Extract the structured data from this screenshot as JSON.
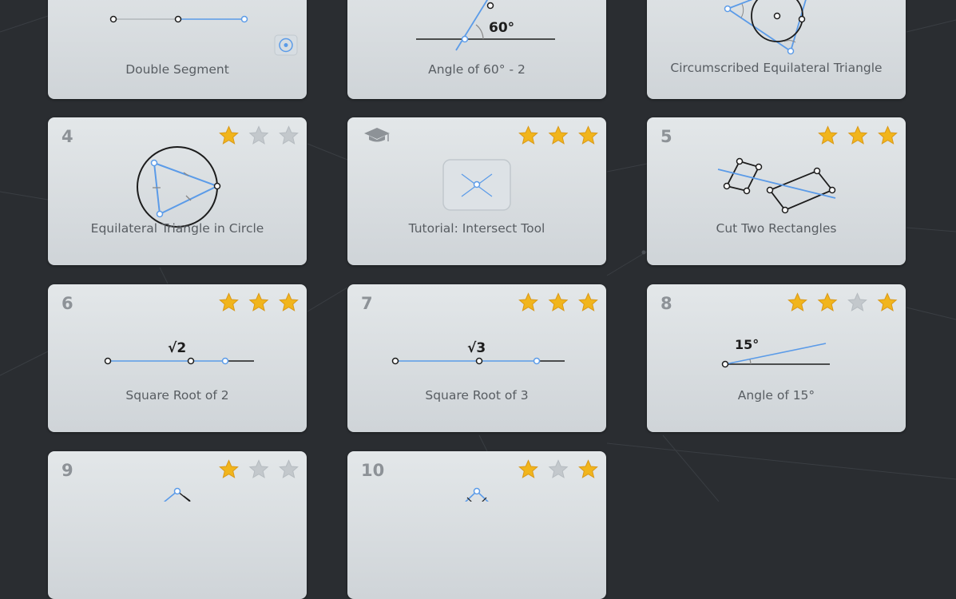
{
  "levels": [
    {
      "title": "Double Segment",
      "stars": null
    },
    {
      "title": "Angle of 60° - 2",
      "stars": null,
      "label": "60°"
    },
    {
      "title": "Circumscribed Equilateral Triangle",
      "stars": null
    },
    {
      "number": "4",
      "title": "Equilateral Triangle in Circle",
      "stars": [
        true,
        false,
        false
      ]
    },
    {
      "number": "",
      "title": "Tutorial: Intersect Tool",
      "stars": [
        true,
        true,
        true
      ],
      "icon": "graduation-cap-icon"
    },
    {
      "number": "5",
      "title": "Cut Two Rectangles",
      "stars": [
        true,
        true,
        true
      ]
    },
    {
      "number": "6",
      "title": "Square Root of 2",
      "stars": [
        true,
        true,
        true
      ],
      "label": "√2"
    },
    {
      "number": "7",
      "title": "Square Root of 3",
      "stars": [
        true,
        true,
        true
      ],
      "label": "√3"
    },
    {
      "number": "8",
      "title": "Angle of 15°",
      "stars": [
        true,
        true,
        false,
        true
      ],
      "label": "15°"
    },
    {
      "number": "9",
      "title": "",
      "stars": [
        true,
        false,
        false
      ]
    },
    {
      "number": "10",
      "title": "",
      "stars": [
        true,
        false,
        true
      ]
    }
  ],
  "colors": {
    "star": "#f1b51c",
    "star_empty": "#c3c8cc",
    "accent": "#5b9be8",
    "line": "#1c1c1c"
  }
}
